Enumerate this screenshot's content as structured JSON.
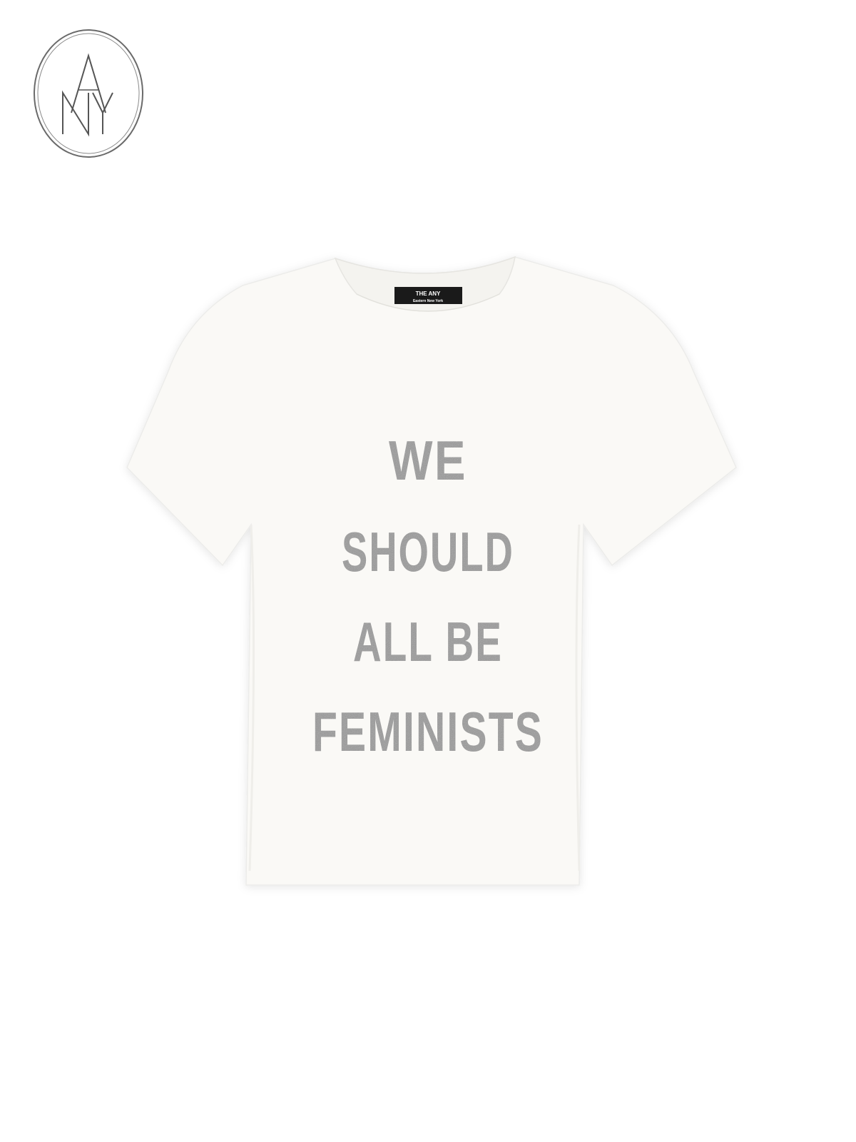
{
  "brand": {
    "logo_name": "ANY",
    "logo_letters": [
      "A",
      "N",
      "Y"
    ]
  },
  "product": {
    "garment": "t-shirt",
    "garment_color": "#faf9f6",
    "print_color": "#9a9a9a",
    "neck_label": {
      "line1": "THE ANY",
      "line2": "Eastern New York"
    },
    "print_lines": [
      "WE",
      "SHOULD",
      "ALL BE",
      "FEMINISTS"
    ]
  }
}
